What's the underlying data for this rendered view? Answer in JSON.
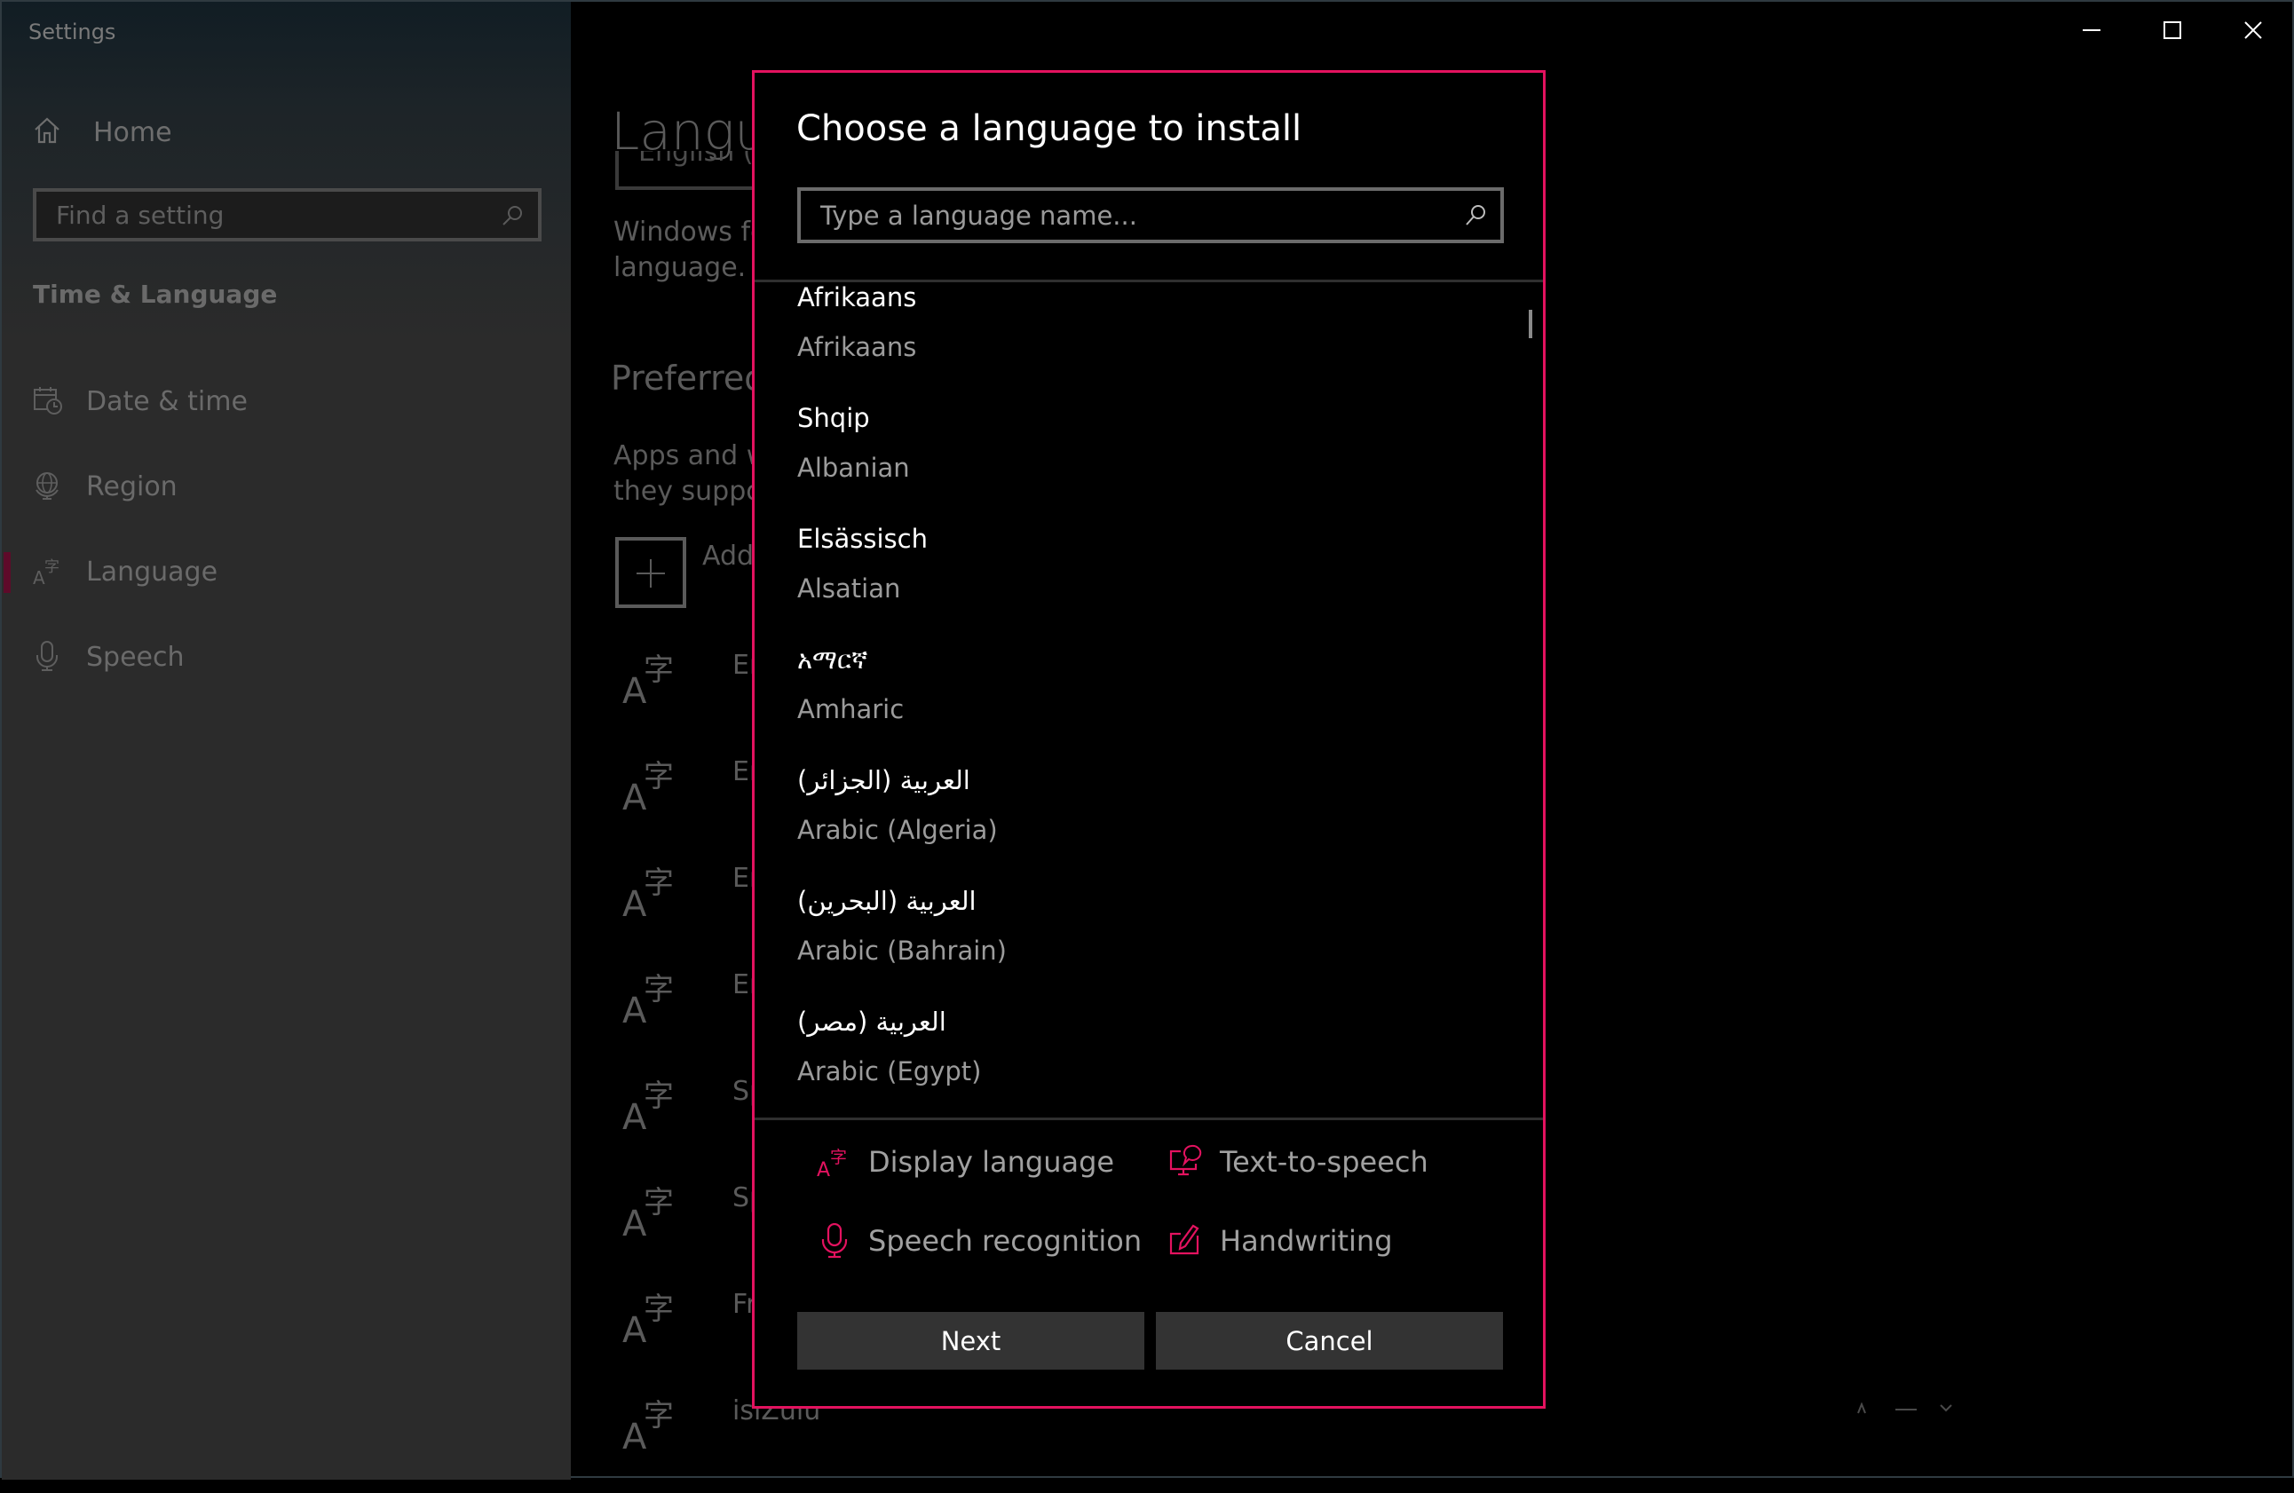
{
  "window": {
    "title": "Settings",
    "controls": {
      "minimize": "minimize",
      "maximize": "maximize",
      "close": "close"
    }
  },
  "sidebar": {
    "home_label": "Home",
    "search_placeholder": "Find a setting",
    "section_heading": "Time & Language",
    "items": [
      {
        "label": "Date & time",
        "icon": "calendar-clock-icon",
        "selected": false
      },
      {
        "label": "Region",
        "icon": "globe-icon",
        "selected": false
      },
      {
        "label": "Language",
        "icon": "language-icon",
        "selected": true
      },
      {
        "label": "Speech",
        "icon": "microphone-icon",
        "selected": false
      }
    ],
    "selected_indicator_color": "#5e0a2a"
  },
  "main": {
    "page_title": "Language",
    "display_language_value": "English (United States)",
    "description_line1": "Windows features like Settings and File Explorer will appear in this",
    "description_line2": "language.",
    "preferred_heading": "Preferred languages",
    "preferred_desc_line1": "Apps and websites will appear in the first language in the list that",
    "preferred_desc_line2": "they support.",
    "add_language_label": "Add a language",
    "preferred_languages": [
      {
        "label": "English"
      },
      {
        "label": "English"
      },
      {
        "label": "English"
      },
      {
        "label": "English"
      },
      {
        "label": "Spanish"
      },
      {
        "label": "Spanish"
      },
      {
        "label": "French"
      },
      {
        "label": "isiZulu"
      }
    ]
  },
  "dialog": {
    "title": "Choose a language to install",
    "search_placeholder": "Type a language name...",
    "search_value": "",
    "languages": [
      {
        "native": "Afrikaans",
        "english": "Afrikaans"
      },
      {
        "native": "Shqip",
        "english": "Albanian"
      },
      {
        "native": "Elsässisch",
        "english": "Alsatian"
      },
      {
        "native": "አማርኛ",
        "english": "Amharic"
      },
      {
        "native": "العربية (الجزائر)",
        "english": "Arabic (Algeria)"
      },
      {
        "native": "العربية (البحرين)",
        "english": "Arabic (Bahrain)"
      },
      {
        "native": "العربية (مصر)",
        "english": "Arabic (Egypt)"
      }
    ],
    "features": [
      {
        "label": "Display language",
        "icon": "display-language-icon"
      },
      {
        "label": "Text-to-speech",
        "icon": "text-to-speech-icon"
      },
      {
        "label": "Speech recognition",
        "icon": "speech-recognition-icon"
      },
      {
        "label": "Handwriting",
        "icon": "handwriting-icon"
      }
    ],
    "next_label": "Next",
    "cancel_label": "Cancel",
    "accent_color": "#e3125f"
  }
}
